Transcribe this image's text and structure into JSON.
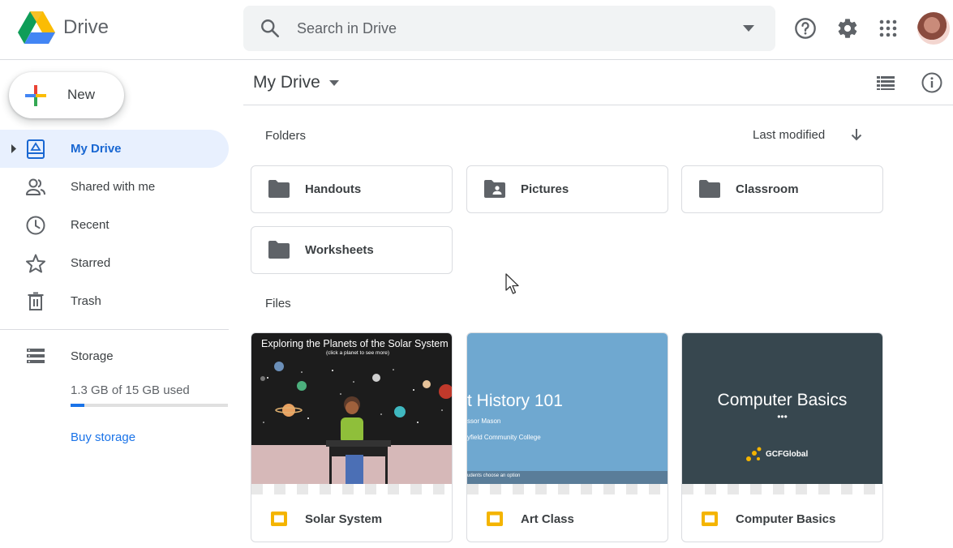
{
  "header": {
    "app_name": "Drive",
    "search_placeholder": "Search in Drive",
    "icons": [
      "drive-logo-icon",
      "search-icon",
      "search-options-icon",
      "help-icon",
      "settings-icon",
      "apps-grid-icon",
      "avatar"
    ]
  },
  "sidebar": {
    "new_label": "New",
    "items": [
      {
        "label": "My Drive",
        "icon": "my-drive-icon",
        "active": true
      },
      {
        "label": "Shared with me",
        "icon": "shared-icon",
        "active": false
      },
      {
        "label": "Recent",
        "icon": "clock-icon",
        "active": false
      },
      {
        "label": "Starred",
        "icon": "star-icon",
        "active": false
      },
      {
        "label": "Trash",
        "icon": "trash-icon",
        "active": false
      }
    ],
    "storage": {
      "label": "Storage",
      "used_text": "1.3 GB of 15 GB used",
      "used_fraction": 0.087,
      "buy_label": "Buy storage"
    }
  },
  "main": {
    "title": "My Drive",
    "folders_label": "Folders",
    "sort_label": "Last modified",
    "files_label": "Files",
    "folders": [
      {
        "label": "Handouts",
        "icon": "folder-icon"
      },
      {
        "label": "Pictures",
        "icon": "shared-folder-icon"
      },
      {
        "label": "Classroom",
        "icon": "folder-icon"
      },
      {
        "label": "Worksheets",
        "icon": "folder-icon"
      }
    ],
    "files": [
      {
        "name": "Solar System",
        "icon": "slides-icon",
        "thumb_title": "Exploring the Planets of the Solar System",
        "thumb_subtitle": "(click a planet to see more)"
      },
      {
        "name": "Art Class",
        "icon": "slides-icon",
        "thumb_title": "t History 101",
        "thumb_line1": "ssor Mason",
        "thumb_line2": "yfield Community College",
        "thumb_footer": "udents choose an option"
      },
      {
        "name": "Computer Basics",
        "icon": "slides-icon",
        "thumb_title": "Computer Basics",
        "thumb_dots": "•••",
        "thumb_logo": "GCFGlobal"
      }
    ]
  },
  "colors": {
    "accent": "#1a73e8",
    "active_bg": "#e8f0fe",
    "slides_yellow": "#f4b400",
    "card_border": "#dadce0",
    "art_thumb": "#6fa8d0",
    "basics_thumb": "#37474f"
  }
}
